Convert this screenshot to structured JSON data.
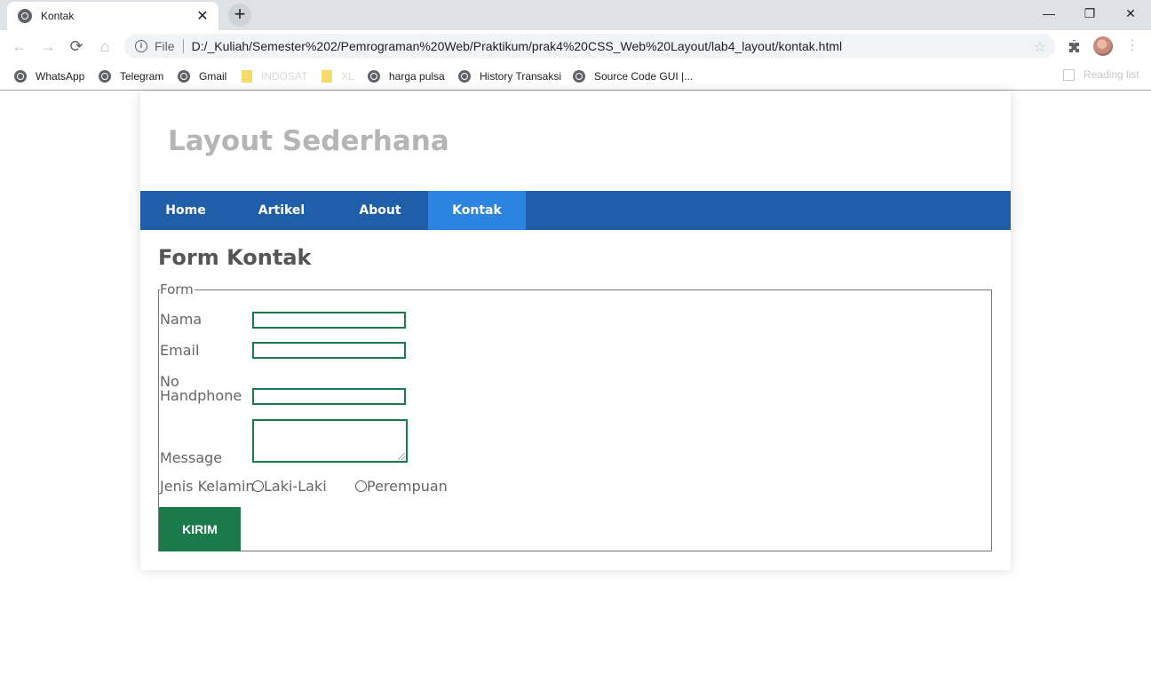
{
  "browser": {
    "tab_title": "Kontak",
    "tab_close": "✕",
    "new_tab": "+",
    "window_controls": {
      "minimize": "—",
      "restore": "❐",
      "close": "✕"
    },
    "address": {
      "scheme_label": "File",
      "url": "D:/_Kuliah/Semester%202/Pemrograman%20Web/Praktikum/prak4%20CSS_Web%20Layout/lab4_layout/kontak.html"
    },
    "bookmarks": [
      {
        "label": "WhatsApp",
        "icon": "globe-icon"
      },
      {
        "label": "Telegram",
        "icon": "globe-icon"
      },
      {
        "label": "Gmail",
        "icon": "globe-icon"
      },
      {
        "label": "INDOSAT",
        "icon": "folder-icon"
      },
      {
        "label": "XL",
        "icon": "folder-icon"
      },
      {
        "label": "harga pulsa",
        "icon": "globe-icon"
      },
      {
        "label": "History Transaksi",
        "icon": "globe-icon"
      },
      {
        "label": "Source Code GUI |...",
        "icon": "globe-icon"
      }
    ],
    "reading_list": "Reading list"
  },
  "site": {
    "title": "Layout Sederhana",
    "nav": [
      {
        "label": "Home",
        "active": false
      },
      {
        "label": "Artikel",
        "active": false
      },
      {
        "label": "About",
        "active": false
      },
      {
        "label": "Kontak",
        "active": true
      }
    ]
  },
  "form": {
    "heading": "Form Kontak",
    "legend": "Form",
    "fields": {
      "nama": {
        "label": "Nama",
        "value": ""
      },
      "email": {
        "label": "Email",
        "value": ""
      },
      "phone": {
        "label_line1": "No",
        "label_line2": "Handphone",
        "value": ""
      },
      "message": {
        "label": "Message",
        "value": ""
      }
    },
    "gender": {
      "label": "Jenis Kelamin",
      "options": [
        "Laki-Laki",
        "Perempuan"
      ],
      "selected": null
    },
    "submit_label": "KIRIM"
  },
  "colors": {
    "nav_bg": "#1f5faa",
    "nav_active_bg": "#2b84e0",
    "accent_green": "#1a7a4a",
    "title_gray": "#b5b5b5"
  }
}
